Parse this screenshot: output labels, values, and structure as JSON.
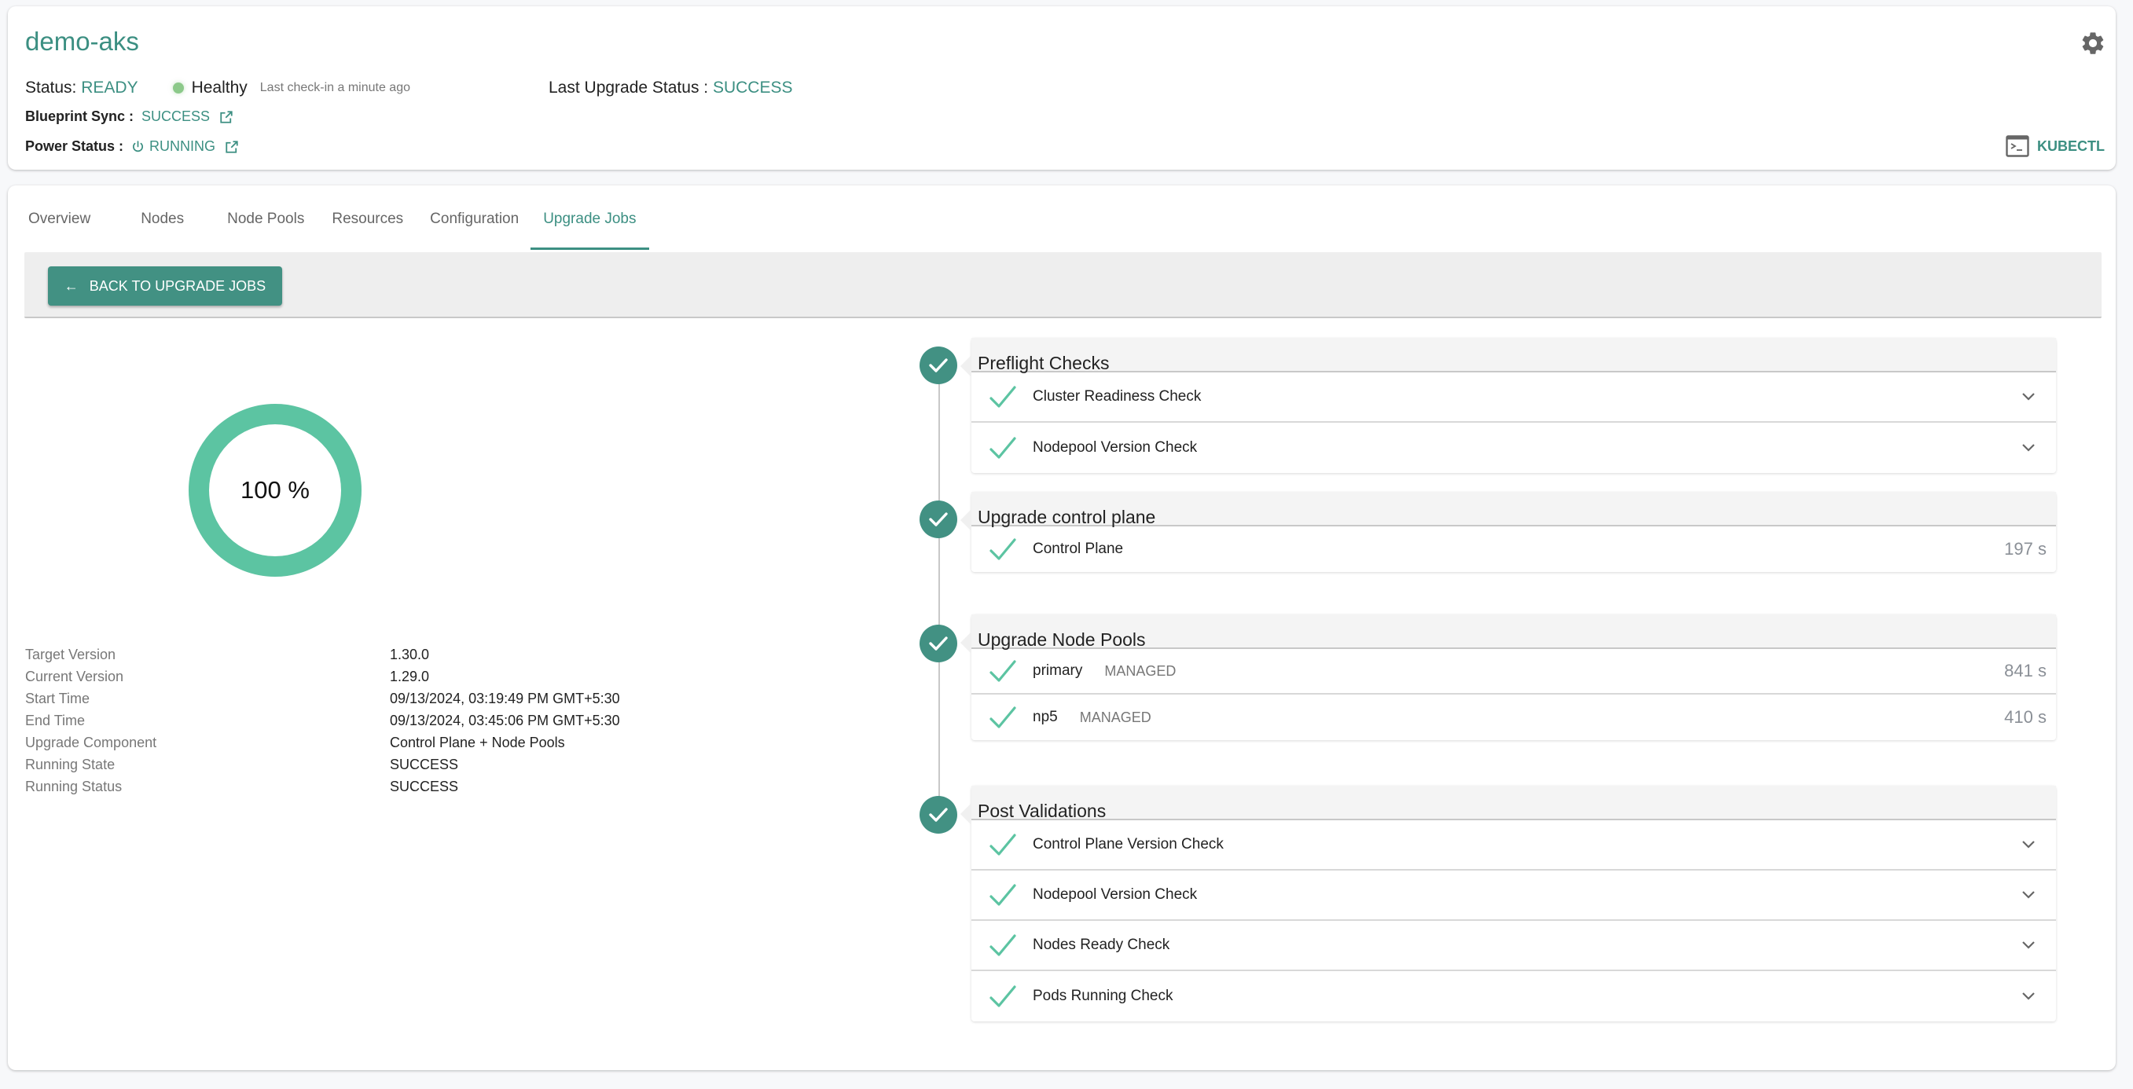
{
  "header": {
    "title": "demo-aks",
    "status_label": "Status:",
    "status_value": "READY",
    "health_label": "Healthy",
    "last_checkin": "Last check-in a minute ago",
    "last_upgrade_label": "Last Upgrade Status :",
    "last_upgrade_value": "SUCCESS",
    "blueprint_label": "Blueprint Sync :",
    "blueprint_value": "SUCCESS",
    "power_label": "Power Status :",
    "power_value": "RUNNING",
    "kubectl_label": "KUBECTL",
    "icons": {
      "settings": "gear-icon",
      "external": "external-link-icon",
      "power": "power-icon",
      "terminal": "terminal-icon"
    }
  },
  "tabs": [
    {
      "label": "Overview",
      "active": false
    },
    {
      "label": "Nodes",
      "active": false
    },
    {
      "label": "Node Pools",
      "active": false
    },
    {
      "label": "Resources",
      "active": false
    },
    {
      "label": "Configuration",
      "active": false
    },
    {
      "label": "Upgrade Jobs",
      "active": true
    }
  ],
  "toolbar": {
    "back_label": "BACK TO UPGRADE JOBS",
    "back_icon": "arrow-left-icon"
  },
  "progress": {
    "percent": 100,
    "label": "100 %"
  },
  "details": [
    {
      "label": "Target Version",
      "value": "1.30.0",
      "accent": true
    },
    {
      "label": "Current Version",
      "value": "1.29.0",
      "accent": false
    },
    {
      "label": "Start Time",
      "value": "09/13/2024, 03:19:49 PM GMT+5:30",
      "accent": false
    },
    {
      "label": "End Time",
      "value": "09/13/2024, 03:45:06 PM GMT+5:30",
      "accent": false
    },
    {
      "label": "Upgrade Component",
      "value": "Control Plane + Node Pools",
      "accent": false
    },
    {
      "label": "Running State",
      "value": "SUCCESS",
      "accent": true
    },
    {
      "label": "Running Status",
      "value": "SUCCESS",
      "accent": true
    }
  ],
  "steps": [
    {
      "title": "Preflight Checks",
      "items": [
        {
          "label": "Cluster Readiness Check",
          "expandable": true
        },
        {
          "label": "Nodepool Version Check",
          "expandable": true
        }
      ]
    },
    {
      "title": "Upgrade control plane",
      "items": [
        {
          "label": "Control Plane",
          "duration": "197 s"
        }
      ]
    },
    {
      "title": "Upgrade Node Pools",
      "items": [
        {
          "label": "primary",
          "tag": "MANAGED",
          "duration": "841 s"
        },
        {
          "label": "np5",
          "tag": "MANAGED",
          "duration": "410 s"
        }
      ]
    },
    {
      "title": "Post Validations",
      "items": [
        {
          "label": "Control Plane Version Check",
          "expandable": true
        },
        {
          "label": "Nodepool Version Check",
          "expandable": true
        },
        {
          "label": "Nodes Ready Check",
          "expandable": true
        },
        {
          "label": "Pods Running Check",
          "expandable": true
        }
      ]
    }
  ],
  "colors": {
    "accent": "#3c8f82",
    "button": "#429183",
    "donut": "#5cc4a2",
    "check": "#5cc4a2",
    "healthy": "#8cc98a"
  }
}
